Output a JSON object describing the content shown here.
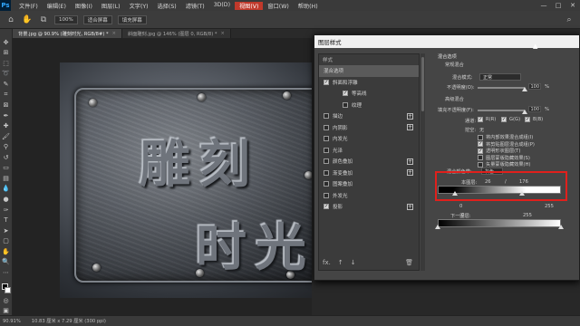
{
  "app": {
    "logo": "Ps"
  },
  "menu": [
    "文件(F)",
    "编辑(E)",
    "图像(I)",
    "图层(L)",
    "文字(Y)",
    "选择(S)",
    "滤镜(T)",
    "3D(D)",
    "视图(V)",
    "窗口(W)",
    "帮助(H)"
  ],
  "menu_highlight_index": 8,
  "window_controls": [
    "—",
    "□",
    "✕"
  ],
  "options": {
    "zoom": "100%",
    "fit_screen": "适合屏幕",
    "fill_screen": "填充屏幕"
  },
  "tabs": [
    {
      "label": "背景.jpg @ 90.9% (雕刻时光, RGB/8#) *",
      "active": true
    },
    {
      "label": "斜面雕刻.jpg @ 146% (图层 0, RGB/8) *",
      "active": false
    }
  ],
  "canvas": {
    "line1": "雕刻",
    "line2": "时光"
  },
  "dialog": {
    "title": "图层样式",
    "styles_header": "样式",
    "styles": [
      {
        "label": "混合选项",
        "type": "plain",
        "selected": true
      },
      {
        "label": "斜面和浮雕",
        "type": "check",
        "checked": true
      },
      {
        "label": "等高线",
        "type": "sub",
        "checked": true
      },
      {
        "label": "纹理",
        "type": "sub",
        "checked": false
      },
      {
        "label": "描边",
        "type": "check",
        "checked": false,
        "plus": true
      },
      {
        "label": "内阴影",
        "type": "check",
        "checked": false,
        "plus": true
      },
      {
        "label": "内发光",
        "type": "check",
        "checked": false
      },
      {
        "label": "光泽",
        "type": "check",
        "checked": false
      },
      {
        "label": "颜色叠加",
        "type": "check",
        "checked": false,
        "plus": true
      },
      {
        "label": "渐变叠加",
        "type": "check",
        "checked": false,
        "plus": true
      },
      {
        "label": "图案叠加",
        "type": "check",
        "checked": false
      },
      {
        "label": "外发光",
        "type": "check",
        "checked": false
      },
      {
        "label": "投影",
        "type": "check",
        "checked": true,
        "plus": true
      }
    ],
    "footer": {
      "fx": "fx.",
      "up": "↑",
      "down": "↓",
      "trash": "🗑"
    },
    "blend": {
      "section": "混合选项",
      "general": "常规混合",
      "mode_label": "混合模式:",
      "mode_value": "正常",
      "opacity_label": "不透明度(O):",
      "opacity_value": "100",
      "opacity_unit": "%",
      "opacity_level": 1.0,
      "advanced": "高级混合",
      "fill_label": "填充不透明度(F):",
      "fill_value": "100",
      "fill_unit": "%",
      "fill_level": 1.0,
      "channels_label": "通道:",
      "channels": [
        "R(R)",
        "G(G)",
        "B(B)"
      ],
      "knockout_label": "挖空:",
      "knockout_value": "无",
      "options": [
        {
          "label": "将内部效果混合成组(I)",
          "checked": false
        },
        {
          "label": "将剪贴图层混合成组(P)",
          "checked": true
        },
        {
          "label": "透明形状图层(T)",
          "checked": true
        },
        {
          "label": "图层蒙版隐藏效果(S)",
          "checked": false
        },
        {
          "label": "矢量蒙版隐藏效果(H)",
          "checked": false
        }
      ],
      "blend_if_label": "混合颜色带:",
      "blend_if_value": "灰色",
      "this_layer_label": "本图层:",
      "this_layer_values": [
        "26",
        "/",
        "176"
      ],
      "this_layer_right": "255",
      "this_layer_left": "0",
      "underlying_label": "下一图层:",
      "underlying_left": "0",
      "underlying_right": "255"
    }
  },
  "status": {
    "zoom": "90.91%",
    "doc": "10.83 厘米 x 7.29 厘米 (300 ppi)"
  },
  "colors": {
    "highlight": "#e0201c",
    "ps_blue": "#31a8ff"
  }
}
